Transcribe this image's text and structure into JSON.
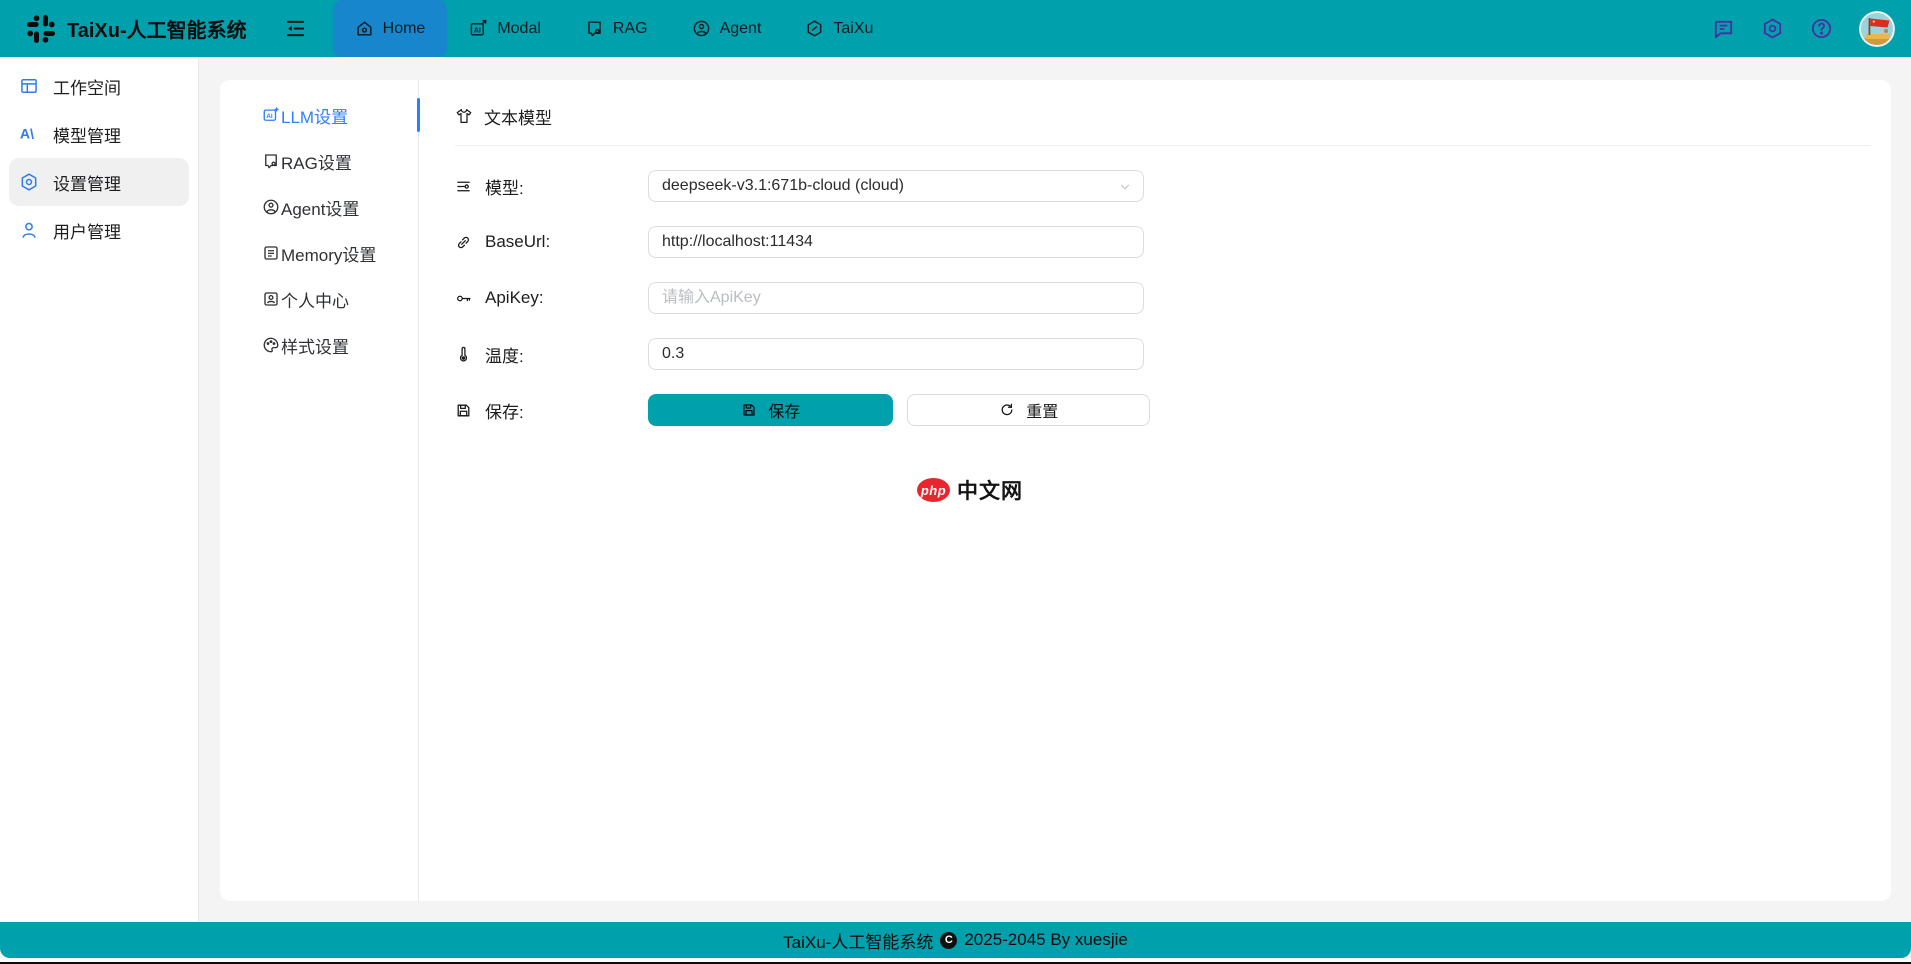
{
  "navbar": {
    "title": "TaiXu-人工智能系统",
    "items": [
      {
        "label": "Home"
      },
      {
        "label": "Modal"
      },
      {
        "label": "RAG"
      },
      {
        "label": "Agent"
      },
      {
        "label": "TaiXu"
      }
    ]
  },
  "sidebar": {
    "items": [
      {
        "label": "工作空间"
      },
      {
        "label": "模型管理"
      },
      {
        "label": "设置管理"
      },
      {
        "label": "用户管理"
      }
    ]
  },
  "settings_tabs": [
    {
      "label": "LLM设置"
    },
    {
      "label": "RAG设置"
    },
    {
      "label": "Agent设置"
    },
    {
      "label": "Memory设置"
    },
    {
      "label": "个人中心"
    },
    {
      "label": "样式设置"
    }
  ],
  "content": {
    "section_title": "文本模型",
    "form": {
      "model_label": "模型:",
      "model_value": "deepseek-v3.1:671b-cloud (cloud)",
      "baseurl_label": "BaseUrl:",
      "baseurl_value": "http://localhost:11434",
      "apikey_label": "ApiKey:",
      "apikey_placeholder": "请输入ApiKey",
      "temp_label": "温度:",
      "temp_value": "0.3",
      "save_label": "保存:",
      "save_button": "保存",
      "reset_button": "重置"
    },
    "brand": {
      "badge": "php",
      "name": "中文网"
    }
  },
  "footer": {
    "site": "TaiXu-人工智能系统",
    "copyright_glyph": "C",
    "rights": "2025-2045 By xuesjie"
  },
  "colors": {
    "teal": "#00a0ac",
    "nav_active_blue": "#1786cd",
    "tab_active_blue": "#2b7fff",
    "sidebar_icon_blue": "#2e7ce8",
    "brand_red": "#e8262d",
    "panel_bg": "#ffffff",
    "page_bg": "#f4f4f5"
  }
}
